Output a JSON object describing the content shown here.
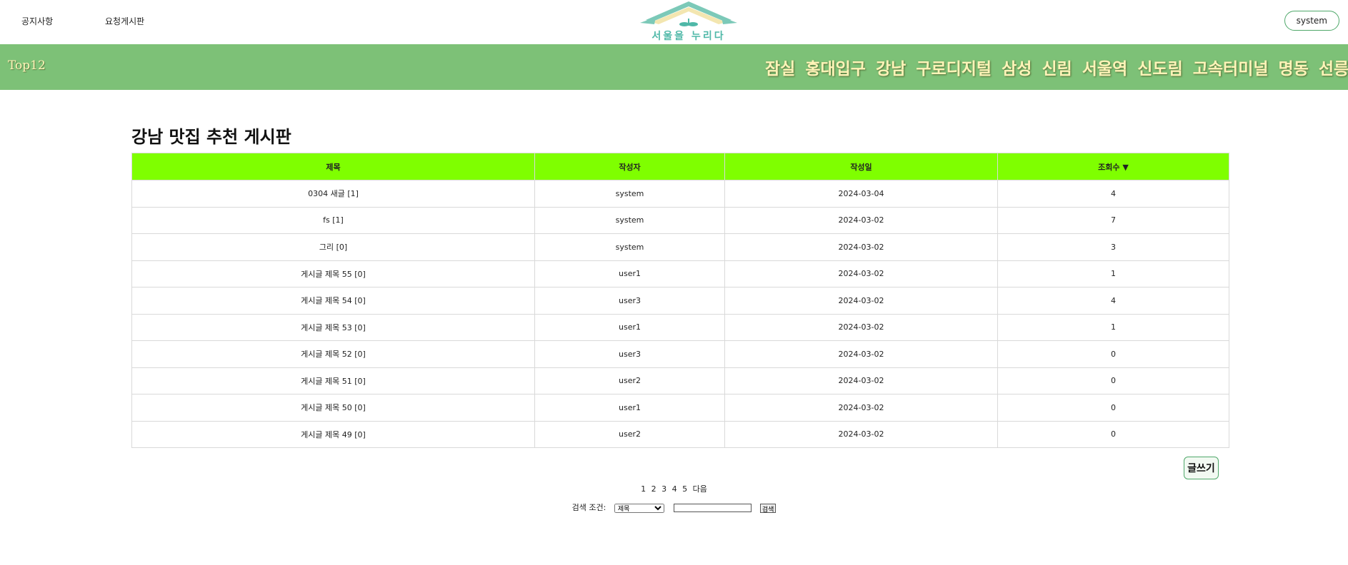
{
  "header": {
    "nav_notice": "공지사항",
    "nav_request": "요청게시판",
    "logo_text": "서울을 누리다",
    "user": "system"
  },
  "ribbon": {
    "title": "Top12",
    "items": [
      "잠실",
      "홍대입구",
      "강남",
      "구로디지털",
      "삼성",
      "신림",
      "서울역",
      "신도림",
      "고속터미널",
      "명동",
      "선릉"
    ]
  },
  "board": {
    "title": "강남 맛집 추천 게시판",
    "columns": {
      "title": "제목",
      "author": "작성자",
      "date": "작성일",
      "views": "조회수 ▼"
    },
    "rows": [
      {
        "title": "0304 새글 [1]",
        "author": "system",
        "date": "2024-03-04",
        "views": "4"
      },
      {
        "title": "fs [1]",
        "author": "system",
        "date": "2024-03-02",
        "views": "7"
      },
      {
        "title": "그리 [0]",
        "author": "system",
        "date": "2024-03-02",
        "views": "3"
      },
      {
        "title": "게시글 제목 55 [0]",
        "author": "user1",
        "date": "2024-03-02",
        "views": "1"
      },
      {
        "title": "게시글 제목 54 [0]",
        "author": "user3",
        "date": "2024-03-02",
        "views": "4"
      },
      {
        "title": "게시글 제목 53 [0]",
        "author": "user1",
        "date": "2024-03-02",
        "views": "1"
      },
      {
        "title": "게시글 제목 52 [0]",
        "author": "user3",
        "date": "2024-03-02",
        "views": "0"
      },
      {
        "title": "게시글 제목 51 [0]",
        "author": "user2",
        "date": "2024-03-02",
        "views": "0"
      },
      {
        "title": "게시글 제목 50 [0]",
        "author": "user1",
        "date": "2024-03-02",
        "views": "0"
      },
      {
        "title": "게시글 제목 49 [0]",
        "author": "user2",
        "date": "2024-03-02",
        "views": "0"
      }
    ],
    "write_label": "글쓰기"
  },
  "pager": {
    "pages": [
      "1",
      "2",
      "3",
      "4",
      "5"
    ],
    "next_label": "다음"
  },
  "search": {
    "label": "검색 조건:",
    "selected": "제목",
    "query": "",
    "button_label": "검색"
  },
  "colors": {
    "ribbon_bg": "#7dc177",
    "header_row_bg": "#7fff00",
    "ribbon_text": "#fff4b8",
    "accent": "#4fa86a"
  }
}
